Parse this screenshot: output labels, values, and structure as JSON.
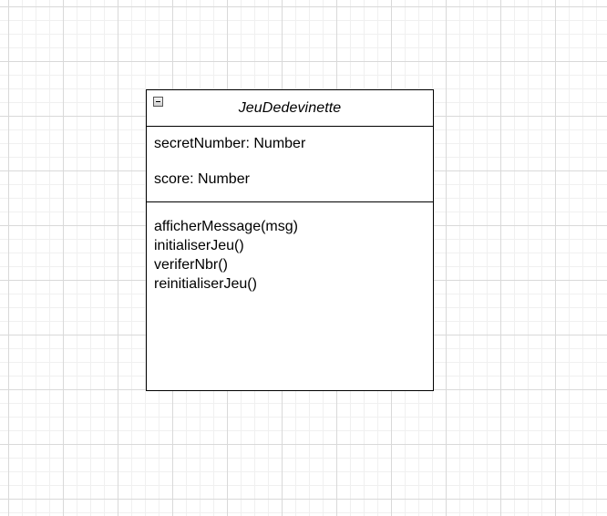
{
  "diagram": {
    "class": {
      "name": "JeuDedevinette",
      "collapse_icon": "collapse-minus-icon",
      "attributes": [
        {
          "text": "secretNumber: Number"
        },
        {
          "text": "score: Number"
        }
      ],
      "methods": [
        {
          "text": "afficherMessage(msg)"
        },
        {
          "text": "initialiserJeu()"
        },
        {
          "text": "veriferNbr()"
        },
        {
          "text": "reinitialiserJeu()"
        }
      ]
    },
    "colors": {
      "grid_major": "#d9d9d9",
      "grid_minor": "#f0f0f0",
      "border": "#000000",
      "background": "#ffffff"
    }
  }
}
